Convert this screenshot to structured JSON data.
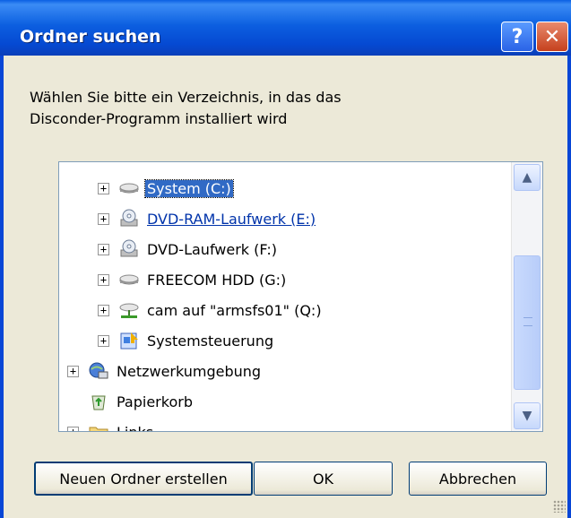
{
  "window": {
    "title": "Ordner suchen"
  },
  "titlebar": {
    "help_symbol": "?",
    "close_symbol": "✕"
  },
  "prompt": {
    "line1": "Wählen Sie bitte ein Verzeichnis, in das das",
    "line2": "Disconder-Programm installiert wird"
  },
  "tree": {
    "items": [
      {
        "label": "System (C:)",
        "icon": "hard-drive-icon",
        "state": "selected"
      },
      {
        "label": "DVD-RAM-Laufwerk (E:)",
        "icon": "dvd-drive-icon",
        "state": "hover"
      },
      {
        "label": "DVD-Laufwerk (F:)",
        "icon": "dvd-drive-icon",
        "state": "normal"
      },
      {
        "label": "FREECOM HDD (G:)",
        "icon": "hard-drive-icon",
        "state": "normal"
      },
      {
        "label": "cam auf \"armsfs01\" (Q:)",
        "icon": "network-drive-icon",
        "state": "normal"
      },
      {
        "label": "Systemsteuerung",
        "icon": "control-panel-icon",
        "state": "normal"
      },
      {
        "label": "Netzwerkumgebung",
        "icon": "network-places-icon",
        "state": "normal"
      },
      {
        "label": "Papierkorb",
        "icon": "recycle-bin-icon",
        "state": "normal"
      },
      {
        "label": "Links",
        "icon": "folder-icon",
        "state": "partial"
      }
    ]
  },
  "buttons": {
    "new_folder": "Neuen Ordner erstellen",
    "ok": "OK",
    "cancel": "Abbrechen"
  },
  "colors": {
    "titlebar": "#0a5fe3",
    "selection": "#316ac5",
    "dialog_bg": "#ece9d8"
  }
}
